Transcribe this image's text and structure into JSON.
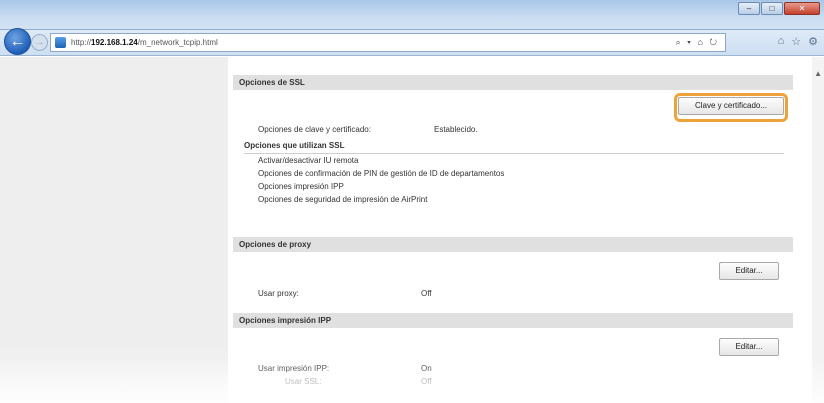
{
  "browser": {
    "url_prefix": "http://",
    "url_host": "192.168.1.24",
    "url_path": "/m_network_tcpip.html",
    "addr_tools": "⌕ ▾ ⌂ ↻",
    "win_min": "–",
    "win_max": "□",
    "win_close": "✕"
  },
  "ssl": {
    "header": "Opciones de SSL",
    "key_cert_button": "Clave y certificado...",
    "key_cert_label": "Opciones de clave y certificado:",
    "key_cert_value": "Establecido.",
    "uses_ssl_heading": "Opciones que utilizan SSL",
    "items": [
      "Activar/desactivar IU remota",
      "Opciones de confirmación de PIN de gestión de ID de departamentos",
      "Opciones impresión IPP",
      "Opciones de seguridad de impresión de AirPrint"
    ]
  },
  "proxy": {
    "header": "Opciones de proxy",
    "edit_button": "Editar...",
    "use_proxy_label": "Usar proxy:",
    "use_proxy_value": "Off"
  },
  "ipp": {
    "header": "Opciones impresión IPP",
    "edit_button": "Editar...",
    "use_ipp_label": "Usar impresión IPP:",
    "use_ipp_value": "On",
    "use_ssl_label": "Usar SSL:",
    "use_ssl_value": "Off"
  },
  "icons": [
    "back-icon",
    "forward-icon",
    "page-icon",
    "home-icon",
    "star-icon",
    "gear-icon"
  ],
  "colors": {
    "highlight": "#f0a23a",
    "section_header_bg": "#e0e0e0",
    "left_pane_bg": "#eeeeee"
  }
}
